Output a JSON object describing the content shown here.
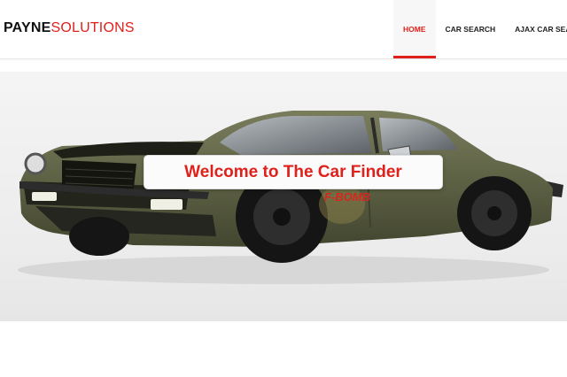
{
  "brand": {
    "part1": "PAYNE",
    "part2": "SOLUTIONS",
    "accent_color": "#e0201b"
  },
  "nav": {
    "items": [
      {
        "label": "HOME",
        "active": true
      },
      {
        "label": "CAR SEARCH",
        "active": false
      },
      {
        "label": "AJAX CAR SEA",
        "active": false
      }
    ]
  },
  "hero": {
    "title": "Welcome to The Car Finder",
    "image": "muscle-car-photo",
    "decal_text": "F-BOMB"
  }
}
